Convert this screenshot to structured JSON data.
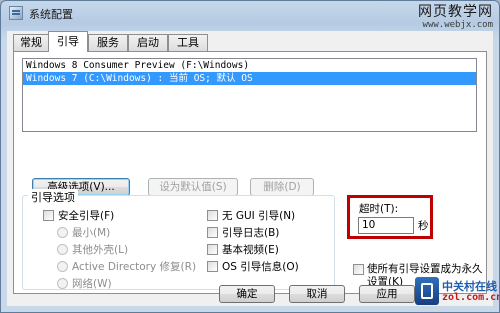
{
  "window": {
    "title": "系统配置"
  },
  "watermark_top": {
    "line1": "网页教学网",
    "line2": "www.webjx.com"
  },
  "tabs": [
    {
      "label": "常规"
    },
    {
      "label": "引导"
    },
    {
      "label": "服务"
    },
    {
      "label": "启动"
    },
    {
      "label": "工具"
    }
  ],
  "active_tab": "引导",
  "os_list": [
    {
      "label": "Windows 8 Consumer Preview (F:\\Windows)",
      "selected": false
    },
    {
      "label": "Windows 7 (C:\\Windows) : 当前 OS; 默认 OS",
      "selected": true
    }
  ],
  "buttons": {
    "advanced": "高级选项(V)...",
    "set_default": "设为默认值(S)",
    "delete": "删除(D)"
  },
  "boot_options": {
    "legend": "引导选项",
    "safe_boot": "安全引导(F)",
    "radios": [
      "最小(M)",
      "其他外壳(L)",
      "Active Directory 修复(R)",
      "网络(W)"
    ],
    "no_gui": "无 GUI 引导(N)",
    "boot_log": "引导日志(B)",
    "base_video": "基本视频(E)",
    "os_boot_info": "OS 引导信息(O)"
  },
  "timeout": {
    "label": "超时(T):",
    "value": "10",
    "unit": "秒"
  },
  "persist": {
    "label": "使所有引导设置成为永久设置(K)"
  },
  "footer": {
    "ok": "确定",
    "cancel": "取消",
    "apply": "应用"
  },
  "watermark_bottom": {
    "line1": "中关村在线",
    "line2": "zol.com.cn"
  },
  "colors": {
    "highlight_border": "#c00000",
    "selection": "#3399ff",
    "title_bar": "#b5cbe3"
  }
}
